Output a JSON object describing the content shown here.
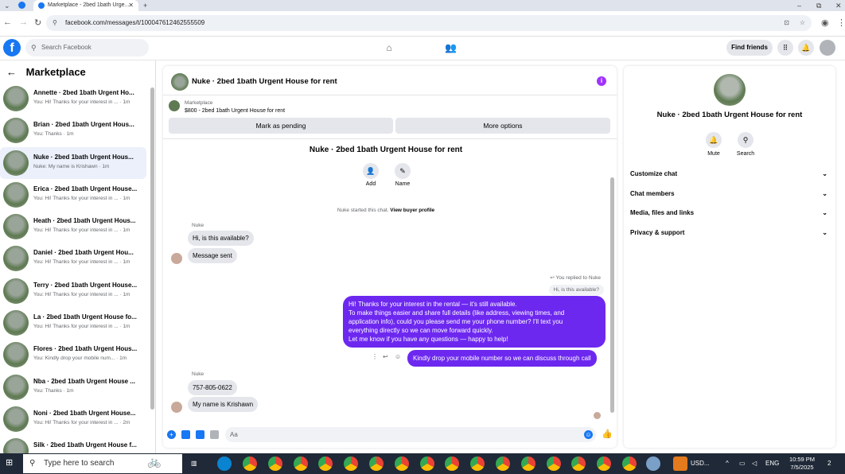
{
  "browser": {
    "tab_title": "Marketplace - 2bed 1bath Urge...",
    "url": "facebook.com/messages/t/100047612462555509",
    "new_tab": "+",
    "window_controls": [
      "–",
      "⧉",
      "✕"
    ]
  },
  "fb_header": {
    "logo": "f",
    "search_placeholder": "Search Facebook",
    "find_friends": "Find friends"
  },
  "left_pane": {
    "title": "Marketplace",
    "conversations": [
      {
        "name": "Annette · 2bed 1bath Urgent Ho...",
        "preview": "You: Hi! Thanks for your interest in ... · 1m"
      },
      {
        "name": "Brian · 2bed 1bath Urgent Hous...",
        "preview": "You: Thanks · 1m"
      },
      {
        "name": "Nuke · 2bed 1bath Urgent Hous...",
        "preview": "Nuke: My name is Krishawn · 1m"
      },
      {
        "name": "Erica · 2bed 1bath Urgent House...",
        "preview": "You: Hi! Thanks for your interest in ... · 1m"
      },
      {
        "name": "Heath · 2bed 1bath Urgent Hous...",
        "preview": "You: Hi! Thanks for your interest in ... · 1m"
      },
      {
        "name": "Daniel · 2bed 1bath Urgent Hou...",
        "preview": "You: Hi! Thanks for your interest in ... · 1m"
      },
      {
        "name": "Terry · 2bed 1bath Urgent House...",
        "preview": "You: Hi! Thanks for your interest in ... · 1m"
      },
      {
        "name": "La · 2bed 1bath Urgent House fo...",
        "preview": "You: Hi! Thanks for your interest in ... · 1m"
      },
      {
        "name": "Flores · 2bed 1bath Urgent Hous...",
        "preview": "You: Kindly drop your mobile num... · 1m"
      },
      {
        "name": "Nba · 2bed 1bath Urgent House ...",
        "preview": "You: Thanks · 1m"
      },
      {
        "name": "Noni · 2bed 1bath Urgent House...",
        "preview": "You: Hi! Thanks for your interest in ... · 2m"
      },
      {
        "name": "Silk · 2bed 1bath Urgent House f...",
        "preview": ""
      }
    ],
    "active_index": 2
  },
  "chat": {
    "title": "Nuke · 2bed 1bath Urgent House for rent",
    "marketplace_label": "Marketplace",
    "listing": "$800 - 2bed 1bath Urgent House for rent",
    "mark_pending": "Mark as pending",
    "more_options": "More options",
    "conv_title": "Nuke · 2bed 1bath Urgent House for rent",
    "add_label": "Add",
    "name_label": "Name",
    "started_text": "Nuke started this chat.",
    "view_buyer": "View buyer profile",
    "sender_name_1": "Nuke",
    "msg_in_1": "Hi, is this available?",
    "msg_in_2": "Message sent",
    "replied_to": "You replied to Nuke",
    "quoted": "Hi, is this available?",
    "msg_out_1_lines": [
      "Hi! Thanks for your interest in the rental — it's still available.",
      "To make things easier and share full details (like address, viewing times, and",
      "application info), could you please send me your phone number? I'll text you",
      "everything directly so we can move forward quickly.",
      "Let me know if you have any questions — happy to help!"
    ],
    "msg_out_2": "Kindly drop your mobile number so we can discuss through call",
    "sender_name_2": "Nuke",
    "msg_in_3": "757-805-0622",
    "msg_in_4": "My name is Krishawn",
    "composer_placeholder": "Aa"
  },
  "right_panel": {
    "title": "Nuke · 2bed 1bath Urgent House for rent",
    "mute": "Mute",
    "search": "Search",
    "rows": [
      "Customize chat",
      "Chat members",
      "Media, files and links",
      "Privacy & support"
    ]
  },
  "taskbar": {
    "search_placeholder": "Type here to search",
    "currency": "USD...",
    "lang": "ENG",
    "time": "10:59 PM",
    "date": "7/5/2025",
    "notif": "2"
  }
}
